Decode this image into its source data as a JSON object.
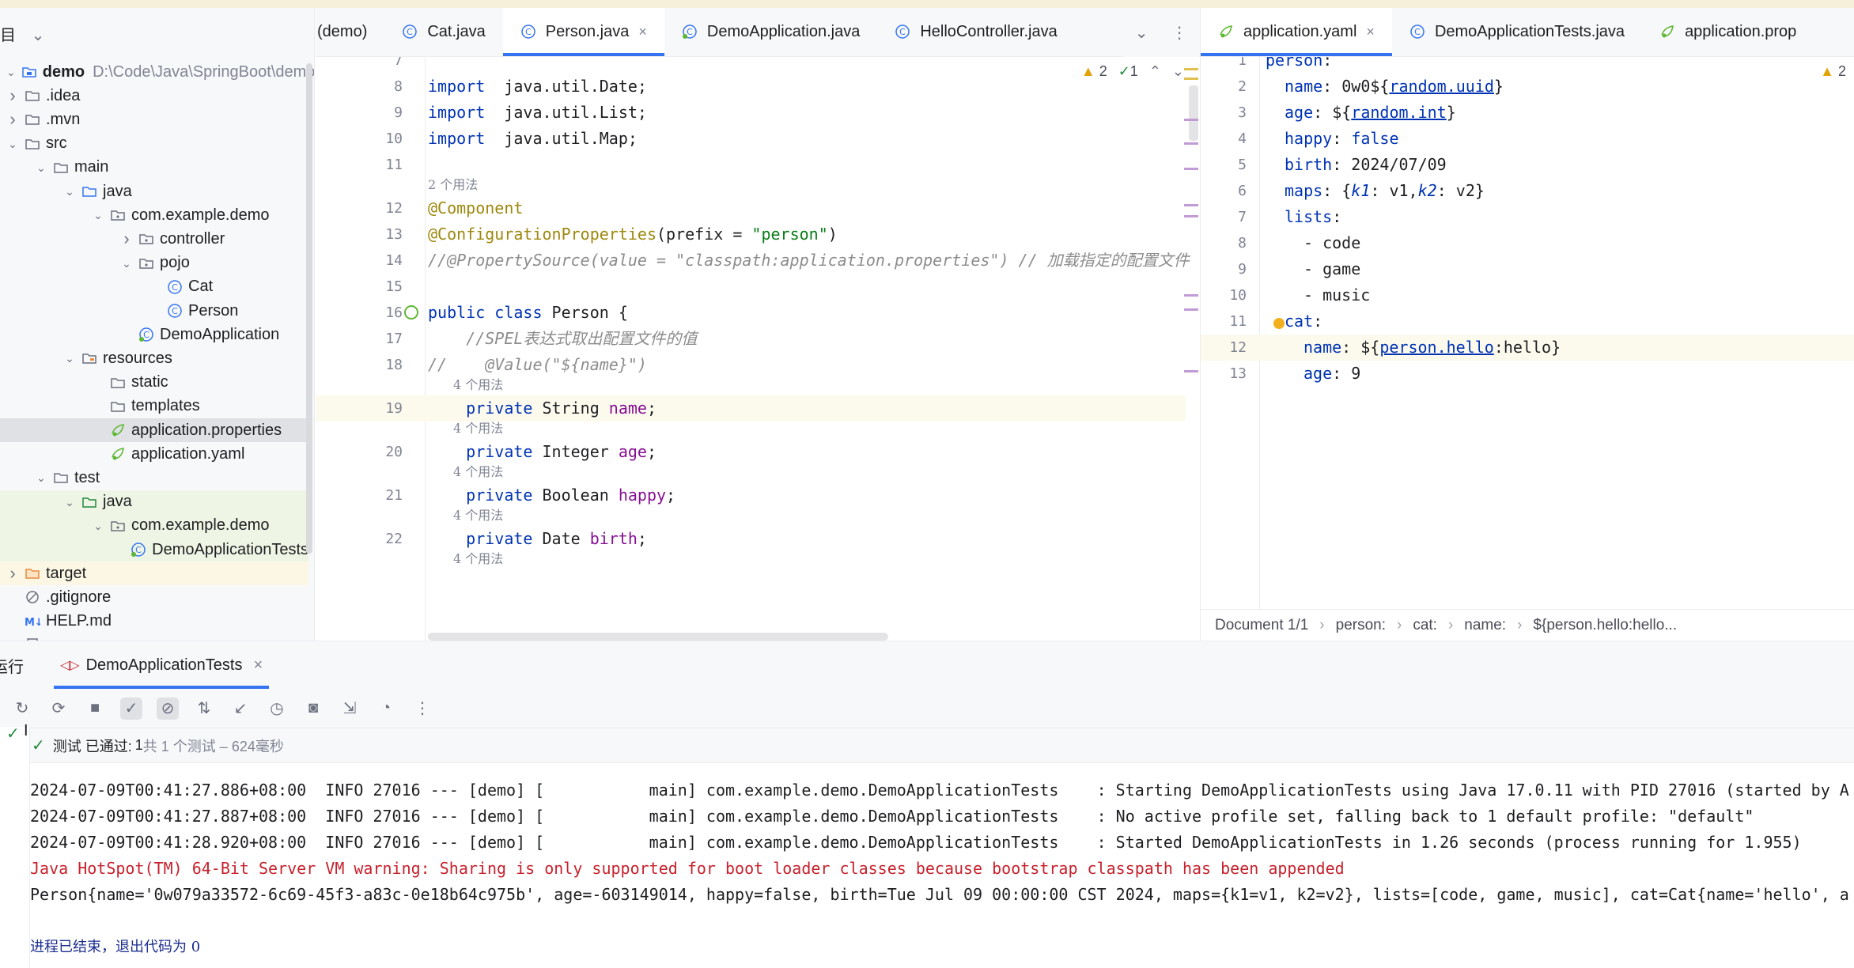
{
  "project": {
    "header": "目",
    "items": [
      {
        "label": "demo",
        "path": "D:\\Code\\Java\\SpringBoot\\demo",
        "icon": "module-folder-icon",
        "depth": 0,
        "arrow": "down"
      },
      {
        "label": ".idea",
        "icon": "folder-icon",
        "depth": 0,
        "arrow": "right"
      },
      {
        "label": ".mvn",
        "icon": "folder-icon",
        "depth": 0,
        "arrow": "right"
      },
      {
        "label": "src",
        "icon": "folder-icon",
        "depth": 0,
        "arrow": "down"
      },
      {
        "label": "main",
        "icon": "folder-icon",
        "depth": 1,
        "arrow": "down"
      },
      {
        "label": "java",
        "icon": "source-folder-icon",
        "depth": 2,
        "arrow": "down"
      },
      {
        "label": "com.example.demo",
        "icon": "package-icon",
        "depth": 3,
        "arrow": "down"
      },
      {
        "label": "controller",
        "icon": "package-icon",
        "depth": 4,
        "arrow": "right"
      },
      {
        "label": "pojo",
        "icon": "package-icon",
        "depth": 4,
        "arrow": "down"
      },
      {
        "label": "Cat",
        "icon": "class-icon",
        "depth": 5,
        "arrow": ""
      },
      {
        "label": "Person",
        "icon": "class-icon",
        "depth": 5,
        "arrow": ""
      },
      {
        "label": "DemoApplication",
        "icon": "spring-class-icon",
        "depth": 4,
        "arrow": ""
      },
      {
        "label": "resources",
        "icon": "resources-folder-icon",
        "depth": 2,
        "arrow": "down"
      },
      {
        "label": "static",
        "icon": "folder-icon",
        "depth": 3,
        "arrow": ""
      },
      {
        "label": "templates",
        "icon": "folder-icon",
        "depth": 3,
        "arrow": ""
      },
      {
        "label": "application.properties",
        "icon": "spring-config-icon",
        "depth": 3,
        "arrow": "",
        "selected": true
      },
      {
        "label": "application.yaml",
        "icon": "spring-config-icon",
        "depth": 3,
        "arrow": ""
      },
      {
        "label": "test",
        "icon": "folder-icon",
        "depth": 1,
        "arrow": "down"
      },
      {
        "label": "java",
        "icon": "test-folder-icon",
        "depth": 2,
        "arrow": "down",
        "test": true
      },
      {
        "label": "com.example.demo",
        "icon": "package-icon",
        "depth": 3,
        "arrow": "down",
        "test": true
      },
      {
        "label": "DemoApplicationTests",
        "icon": "spring-class-icon",
        "depth": 4,
        "arrow": "",
        "test": true
      },
      {
        "label": "target",
        "icon": "excluded-folder-icon",
        "depth": 0,
        "arrow": "right",
        "excluded": true
      },
      {
        "label": ".gitignore",
        "icon": "ignore-file-icon",
        "depth": 0,
        "arrow": ""
      },
      {
        "label": "HELP.md",
        "icon": "markdown-icon",
        "depth": 0,
        "arrow": ""
      },
      {
        "label": "mvnw",
        "icon": "file-icon",
        "depth": 0,
        "arrow": ""
      }
    ]
  },
  "left_tabs": [
    {
      "label": "(demo)",
      "icon": ""
    },
    {
      "label": "Cat.java",
      "icon": "class-icon"
    },
    {
      "label": "Person.java",
      "icon": "class-icon",
      "active": true,
      "close": "×"
    },
    {
      "label": "DemoApplication.java",
      "icon": "spring-class-icon"
    },
    {
      "label": "HelloController.java",
      "icon": "class-icon"
    }
  ],
  "right_tabs": [
    {
      "label": "application.yaml",
      "icon": "spring-config-icon",
      "active": true,
      "close": "×"
    },
    {
      "label": "DemoApplicationTests.java",
      "icon": "class-icon"
    },
    {
      "label": "application.prop",
      "icon": "spring-config-icon"
    }
  ],
  "left_editor": {
    "warnings": "2",
    "weak_warnings": "1",
    "lines": [
      {
        "n": "7",
        "tokens": []
      },
      {
        "n": "8",
        "tokens": [
          [
            "kw",
            "import"
          ],
          [
            "",
            "  java.util.Date;"
          ]
        ]
      },
      {
        "n": "9",
        "tokens": [
          [
            "kw",
            "import"
          ],
          [
            "",
            "  java.util.List;"
          ]
        ]
      },
      {
        "n": "10",
        "tokens": [
          [
            "kw",
            "import"
          ],
          [
            "",
            "  java.util.Map;"
          ]
        ]
      },
      {
        "n": "11",
        "tokens": []
      },
      {
        "hint": "2 个用法"
      },
      {
        "n": "12",
        "tokens": [
          [
            "an",
            "@Component"
          ]
        ]
      },
      {
        "n": "13",
        "tokens": [
          [
            "an",
            "@ConfigurationProperties"
          ],
          [
            "",
            "(prefix = "
          ],
          [
            "str",
            "\"person\""
          ],
          [
            "",
            ")"
          ]
        ]
      },
      {
        "n": "14",
        "tokens": [
          [
            "cm",
            "//@PropertySource(value = \"classpath:application.properties\") // 加载指定的配置文件"
          ]
        ]
      },
      {
        "n": "15",
        "tokens": []
      },
      {
        "n": "16",
        "tokens": [
          [
            "kw",
            "public class"
          ],
          [
            "",
            " Person {"
          ]
        ]
      },
      {
        "n": "17",
        "tokens": [
          [
            "cm",
            "    //SPEL表达式取出配置文件的值"
          ]
        ]
      },
      {
        "n": "18",
        "tokens": [
          [
            "cm",
            "//    @Value(\"${name}\")"
          ]
        ]
      },
      {
        "hint": "4 个用法"
      },
      {
        "n": "19",
        "tokens": [
          [
            "kw",
            "    private"
          ],
          [
            "",
            " String "
          ],
          [
            "fld",
            "name"
          ],
          [
            "",
            ";"
          ]
        ],
        "highlight": true
      },
      {
        "hint": "4 个用法"
      },
      {
        "n": "20",
        "tokens": [
          [
            "kw",
            "    private"
          ],
          [
            "",
            " Integer "
          ],
          [
            "fld",
            "age"
          ],
          [
            "",
            ";"
          ]
        ]
      },
      {
        "hint": "4 个用法"
      },
      {
        "n": "21",
        "tokens": [
          [
            "kw",
            "    private"
          ],
          [
            "",
            " Boolean "
          ],
          [
            "fld",
            "happy"
          ],
          [
            "",
            ";"
          ]
        ]
      },
      {
        "hint": "4 个用法"
      },
      {
        "n": "22",
        "tokens": [
          [
            "kw",
            "    private"
          ],
          [
            "",
            " Date "
          ],
          [
            "fld",
            "birth"
          ],
          [
            "",
            ";"
          ]
        ]
      },
      {
        "hint": "4 个用法"
      }
    ]
  },
  "right_editor": {
    "warnings": "2",
    "lines": [
      {
        "n": "1",
        "indent": 0,
        "tokens": [
          [
            "ykey",
            "person"
          ],
          [
            "",
            ":"
          ]
        ]
      },
      {
        "n": "2",
        "indent": 1,
        "tokens": [
          [
            "ykey",
            "name"
          ],
          [
            "",
            ": 0w0${"
          ],
          [
            "yref",
            "random.uuid"
          ],
          [
            "",
            "}"
          ]
        ]
      },
      {
        "n": "3",
        "indent": 1,
        "tokens": [
          [
            "ykey",
            "age"
          ],
          [
            "",
            ": ${"
          ],
          [
            "yref",
            "random.int"
          ],
          [
            "",
            "}"
          ]
        ]
      },
      {
        "n": "4",
        "indent": 1,
        "tokens": [
          [
            "ykey",
            "happy"
          ],
          [
            "",
            ": "
          ],
          [
            "ykey",
            "false"
          ]
        ]
      },
      {
        "n": "5",
        "indent": 1,
        "tokens": [
          [
            "ykey",
            "birth"
          ],
          [
            "",
            ": 2024/07/09"
          ]
        ]
      },
      {
        "n": "6",
        "indent": 1,
        "tokens": [
          [
            "ykey",
            "maps"
          ],
          [
            "",
            ": {"
          ],
          [
            "yiter",
            "k1"
          ],
          [
            "",
            ": v1,"
          ],
          [
            "yiter",
            "k2"
          ],
          [
            "",
            ": v2}"
          ]
        ]
      },
      {
        "n": "7",
        "indent": 1,
        "tokens": [
          [
            "ykey",
            "lists"
          ],
          [
            "",
            ":"
          ]
        ]
      },
      {
        "n": "8",
        "indent": 2,
        "tokens": [
          [
            "",
            "- code"
          ]
        ]
      },
      {
        "n": "9",
        "indent": 2,
        "tokens": [
          [
            "",
            "- game"
          ]
        ]
      },
      {
        "n": "10",
        "indent": 2,
        "tokens": [
          [
            "",
            "- music"
          ]
        ]
      },
      {
        "n": "11",
        "indent": 1,
        "tokens": [
          [
            "ykey",
            "cat"
          ],
          [
            "",
            ":"
          ]
        ]
      },
      {
        "n": "12",
        "indent": 2,
        "tokens": [
          [
            "ykey",
            "name"
          ],
          [
            "",
            ": ${"
          ],
          [
            "yref",
            "person.hello"
          ],
          [
            "",
            ":hello}"
          ]
        ],
        "highlight": true
      },
      {
        "n": "13",
        "indent": 2,
        "tokens": [
          [
            "ykey",
            "age"
          ],
          [
            "",
            ": 9"
          ]
        ]
      }
    ],
    "breadcrumb": [
      "Document 1/1",
      "person:",
      "cat:",
      "name:",
      "${person.hello:hello..."
    ]
  },
  "run_panel": {
    "title": "运行",
    "tab_label": "DemoApplicationTests",
    "tab_close": "×",
    "status_label": "测试 已通过:",
    "status_passed": "1",
    "status_detail": "共 1 个测试 – 624毫秒",
    "console_lines": [
      {
        "text": "2024-07-09T00:41:27.886+08:00  INFO 27016 --- [demo] [           main] com.example.demo.DemoApplicationTests    : Starting DemoApplicationTests using Java 17.0.11 with PID 27016 (started by A",
        "kind": "info"
      },
      {
        "text": "2024-07-09T00:41:27.887+08:00  INFO 27016 --- [demo] [           main] com.example.demo.DemoApplicationTests    : No active profile set, falling back to 1 default profile: \"default\"",
        "kind": "info"
      },
      {
        "text": "2024-07-09T00:41:28.920+08:00  INFO 27016 --- [demo] [           main] com.example.demo.DemoApplicationTests    : Started DemoApplicationTests in 1.26 seconds (process running for 1.955)",
        "kind": "info"
      },
      {
        "text": "Java HotSpot(TM) 64-Bit Server VM warning: Sharing is only supported for boot loader classes because bootstrap classpath has been appended",
        "kind": "err"
      },
      {
        "text": "Person{name='0w079a33572-6c69-45f3-a83c-0e18b64c975b', age=-603149014, happy=false, birth=Tue Jul 09 00:00:00 CST 2024, maps={k1=v1, k2=v2}, lists=[code, game, music], cat=Cat{name='hello', a",
        "kind": "info"
      },
      {
        "text": "",
        "kind": "info"
      },
      {
        "text": "进程已结束，退出代码为 0",
        "kind": "exit"
      }
    ]
  },
  "colors": {
    "accent": "#3574f0",
    "keyword": "#0033b3",
    "annotation": "#9e880d",
    "string": "#067d17",
    "field": "#871094",
    "error": "#c7222d",
    "success": "#208a3c"
  }
}
